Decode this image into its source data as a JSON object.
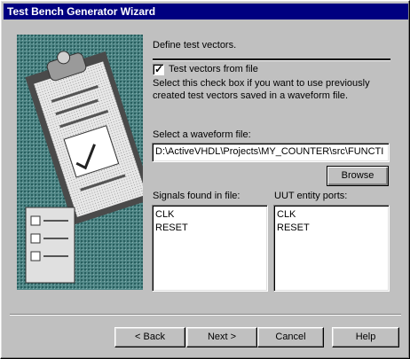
{
  "window": {
    "title": "Test Bench Generator Wizard"
  },
  "content": {
    "heading": "Define test vectors.",
    "checkbox_label": "Test vectors from file",
    "checkbox_checked": true,
    "description_line1": "Select this check box if you want to use previously",
    "description_line2": "created test vectors saved in a waveform file.",
    "waveform_label": "Select a waveform file:",
    "waveform_value": "D:\\ActiveVHDL\\Projects\\MY_COUNTER\\src\\FUNCTI",
    "browse_label": "Browse",
    "signals_label": "Signals found in file:",
    "signals": [
      "CLK",
      "RESET"
    ],
    "ports_label": "UUT entity ports:",
    "ports": [
      "CLK",
      "RESET"
    ]
  },
  "buttons": {
    "back": "< Back",
    "next": "Next >",
    "cancel": "Cancel",
    "help": "Help"
  }
}
